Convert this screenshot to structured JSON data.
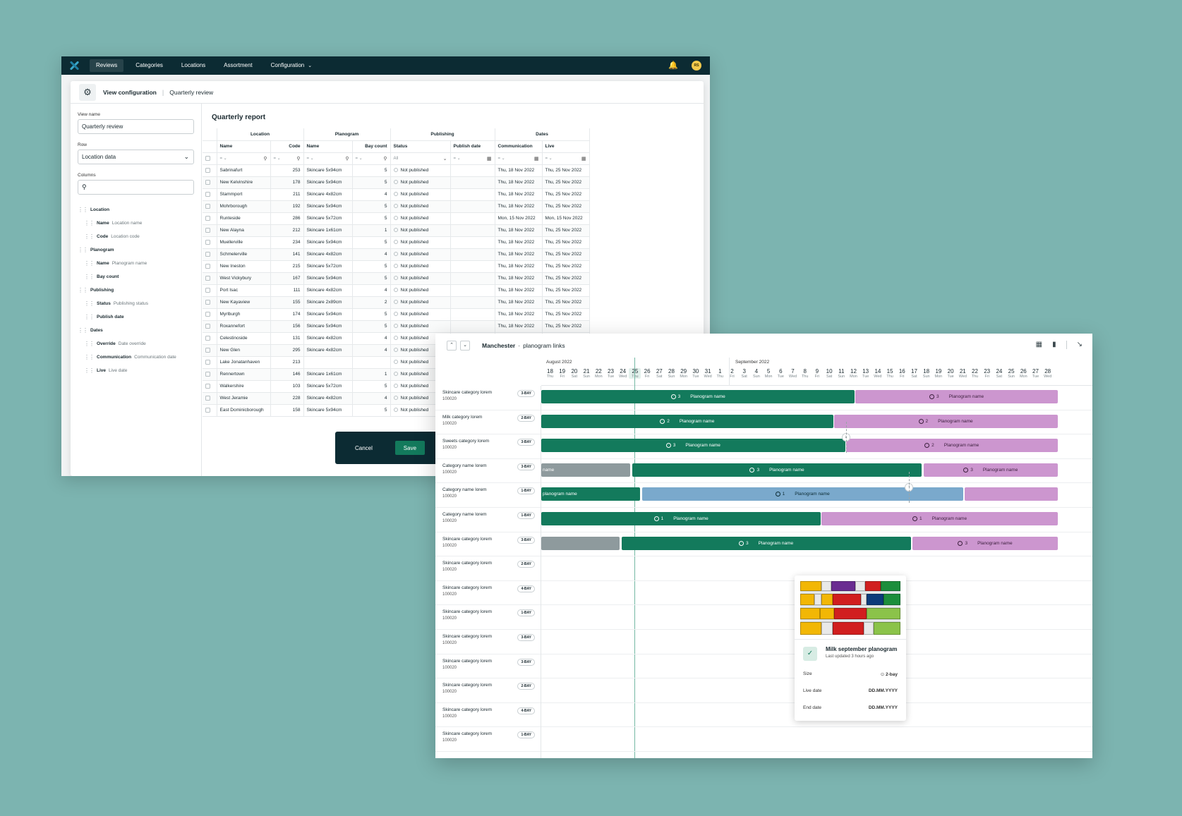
{
  "nav": {
    "items": [
      "Reviews",
      "Categories",
      "Locations",
      "Assortment",
      "Configuration"
    ],
    "avatar": "RS"
  },
  "modal": {
    "title": "View configuration",
    "breadcrumb": "Quarterly review",
    "view_name_label": "View name",
    "view_name_value": "Quarterly review",
    "row_label": "Row",
    "row_value": "Location data",
    "columns_label": "Columns",
    "tree": [
      {
        "name": "Location",
        "level": 0,
        "sub": ""
      },
      {
        "name": "Name",
        "level": 1,
        "sub": "Location name"
      },
      {
        "name": "Code",
        "level": 1,
        "sub": "Location code"
      },
      {
        "name": "Planogram",
        "level": 0,
        "sub": ""
      },
      {
        "name": "Name",
        "level": 1,
        "sub": "Planogram name"
      },
      {
        "name": "Bay count",
        "level": 1,
        "sub": ""
      },
      {
        "name": "Publishing",
        "level": 0,
        "sub": ""
      },
      {
        "name": "Status",
        "level": 1,
        "sub": "Publishing status"
      },
      {
        "name": "Publish date",
        "level": 1,
        "sub": ""
      },
      {
        "name": "Dates",
        "level": 0,
        "sub": ""
      },
      {
        "name": "Override",
        "level": 1,
        "sub": "Date override"
      },
      {
        "name": "Communication",
        "level": 1,
        "sub": "Communication date"
      },
      {
        "name": "Live",
        "level": 1,
        "sub": "Live date"
      }
    ],
    "report_title": "Quarterly report",
    "groups": [
      "Location",
      "Planogram",
      "Publishing",
      "Dates"
    ],
    "columns": [
      "Name",
      "Code",
      "Name",
      "Bay count",
      "Status",
      "Publish date",
      "Communication",
      "Live"
    ],
    "status_filter": "All",
    "rows": [
      [
        "Sabrinafurt",
        "253",
        "Skincare 5x94cm",
        "5",
        "Not published",
        "",
        "Thu, 18 Nov 2022",
        "Thu, 25 Nov 2022"
      ],
      [
        "New Kelvinshire",
        "178",
        "Skincare 5x94cm",
        "5",
        "Not published",
        "",
        "Thu, 18 Nov 2022",
        "Thu, 25 Nov 2022"
      ],
      [
        "Stammport",
        "211",
        "Skincare 4x82cm",
        "4",
        "Not published",
        "",
        "Thu, 18 Nov 2022",
        "Thu, 25 Nov 2022"
      ],
      [
        "Mohrborough",
        "192",
        "Skincare 5x94cm",
        "5",
        "Not published",
        "",
        "Thu, 18 Nov 2022",
        "Thu, 25 Nov 2022"
      ],
      [
        "Runteside",
        "286",
        "Skincare 5x72cm",
        "5",
        "Not published",
        "",
        "Mon, 15 Nov 2022",
        "Mon, 15 Nov 2022"
      ],
      [
        "New Alayna",
        "212",
        "Skincare 1x61cm",
        "1",
        "Not published",
        "",
        "Thu, 18 Nov 2022",
        "Thu, 25 Nov 2022"
      ],
      [
        "Muellerville",
        "234",
        "Skincare 5x94cm",
        "5",
        "Not published",
        "",
        "Thu, 18 Nov 2022",
        "Thu, 25 Nov 2022"
      ],
      [
        "Schmelerville",
        "141",
        "Skincare 4x82cm",
        "4",
        "Not published",
        "",
        "Thu, 18 Nov 2022",
        "Thu, 25 Nov 2022"
      ],
      [
        "New Ineston",
        "215",
        "Skincare 5x72cm",
        "5",
        "Not published",
        "",
        "Thu, 18 Nov 2022",
        "Thu, 25 Nov 2022"
      ],
      [
        "West Vickybury",
        "167",
        "Skincare 5x94cm",
        "5",
        "Not published",
        "",
        "Thu, 18 Nov 2022",
        "Thu, 25 Nov 2022"
      ],
      [
        "Port Isac",
        "111",
        "Skincare 4x82cm",
        "4",
        "Not published",
        "",
        "Thu, 18 Nov 2022",
        "Thu, 25 Nov 2022"
      ],
      [
        "New Kayaview",
        "155",
        "Skincare 2x89cm",
        "2",
        "Not published",
        "",
        "Thu, 18 Nov 2022",
        "Thu, 25 Nov 2022"
      ],
      [
        "Myrlburgh",
        "174",
        "Skincare 5x94cm",
        "5",
        "Not published",
        "",
        "Thu, 18 Nov 2022",
        "Thu, 25 Nov 2022"
      ],
      [
        "Roxannefort",
        "156",
        "Skincare 5x94cm",
        "5",
        "Not published",
        "",
        "Thu, 18 Nov 2022",
        "Thu, 25 Nov 2022"
      ],
      [
        "Celestinoside",
        "131",
        "Skincare 4x82cm",
        "4",
        "Not published",
        "",
        "",
        ""
      ],
      [
        "New Glen",
        "295",
        "Skincare 4x82cm",
        "4",
        "Not published",
        "",
        "",
        ""
      ],
      [
        "Lake Jonatanhaven",
        "213",
        "",
        "",
        "Not published",
        "",
        "",
        ""
      ],
      [
        "Rennertown",
        "146",
        "Skincare 1x61cm",
        "1",
        "Not published",
        "",
        "",
        ""
      ],
      [
        "Walkershire",
        "103",
        "Skincare 5x72cm",
        "5",
        "Not published",
        "",
        "",
        ""
      ],
      [
        "West Jeramie",
        "228",
        "Skincare 4x82cm",
        "4",
        "Not published",
        "",
        "",
        ""
      ],
      [
        "East Dominicborough",
        "158",
        "Skincare 5x94cm",
        "5",
        "Not published",
        "",
        "",
        ""
      ]
    ],
    "cancel_label": "Cancel",
    "save_label": "Save"
  },
  "timeline": {
    "title": "Manchester",
    "subtitle": "planogram links",
    "months": [
      "August 2022",
      "September 2022"
    ],
    "days": [
      [
        "18",
        "Thu"
      ],
      [
        "19",
        "Fri"
      ],
      [
        "20",
        "Sat"
      ],
      [
        "21",
        "Sun"
      ],
      [
        "22",
        "Mon"
      ],
      [
        "23",
        "Tue"
      ],
      [
        "24",
        "Wed"
      ],
      [
        "25",
        "Thu"
      ],
      [
        "26",
        "Fri"
      ],
      [
        "27",
        "Sat"
      ],
      [
        "28",
        "Sun"
      ],
      [
        "29",
        "Mon"
      ],
      [
        "30",
        "Tue"
      ],
      [
        "31",
        "Wed"
      ],
      [
        "1",
        "Thu"
      ],
      [
        "2",
        "Fri"
      ],
      [
        "3",
        "Sat"
      ],
      [
        "4",
        "Sun"
      ],
      [
        "5",
        "Mon"
      ],
      [
        "6",
        "Tue"
      ],
      [
        "7",
        "Wed"
      ],
      [
        "8",
        "Thu"
      ],
      [
        "9",
        "Fri"
      ],
      [
        "10",
        "Sat"
      ],
      [
        "11",
        "Sun"
      ],
      [
        "12",
        "Mon"
      ],
      [
        "13",
        "Tue"
      ],
      [
        "14",
        "Wed"
      ],
      [
        "15",
        "Thu"
      ],
      [
        "16",
        "Fri"
      ],
      [
        "17",
        "Sat"
      ],
      [
        "18",
        "Sun"
      ],
      [
        "19",
        "Mon"
      ],
      [
        "20",
        "Tue"
      ],
      [
        "21",
        "Wed"
      ],
      [
        "22",
        "Thu"
      ],
      [
        "23",
        "Fri"
      ],
      [
        "24",
        "Sat"
      ],
      [
        "25",
        "Sun"
      ],
      [
        "26",
        "Mon"
      ],
      [
        "27",
        "Tue"
      ],
      [
        "28",
        "Wed"
      ]
    ],
    "today_index": 7,
    "rows": [
      {
        "name": "Skincare category lorem",
        "code": "100020",
        "bay": "3-BAY"
      },
      {
        "name": "Milk category lorem",
        "code": "100020",
        "bay": "2-BAY"
      },
      {
        "name": "Sweets category lorem",
        "code": "100020",
        "bay": "3-BAY"
      },
      {
        "name": "Category name lorem",
        "code": "100020",
        "bay": "3-BAY"
      },
      {
        "name": "Category name lorem",
        "code": "100020",
        "bay": "1-BAY"
      },
      {
        "name": "Category name lorem",
        "code": "100020",
        "bay": "1-BAY"
      },
      {
        "name": "Skincare category lorem",
        "code": "100020",
        "bay": "3-BAY"
      },
      {
        "name": "Skincare category lorem",
        "code": "100020",
        "bay": "2-BAY"
      },
      {
        "name": "Skincare category lorem",
        "code": "100020",
        "bay": "4-BAY"
      },
      {
        "name": "Skincare category lorem",
        "code": "100020",
        "bay": "1-BAY"
      },
      {
        "name": "Skincare category lorem",
        "code": "100020",
        "bay": "3-BAY"
      },
      {
        "name": "Skincare category lorem",
        "code": "100020",
        "bay": "3-BAY"
      },
      {
        "name": "Skincare category lorem",
        "code": "100020",
        "bay": "2-BAY"
      },
      {
        "name": "Skincare category lorem",
        "code": "100020",
        "bay": "4-BAY"
      },
      {
        "name": "Skincare category lorem",
        "code": "100020",
        "bay": "1-BAY"
      }
    ],
    "bars": [
      [
        {
          "c": "green",
          "s": 0,
          "e": 25.9,
          "n": "3",
          "t": "Planogram name"
        },
        {
          "c": "pink",
          "s": 25.9,
          "e": 42.6,
          "n": "3",
          "t": "Planogram name"
        }
      ],
      [
        {
          "c": "green",
          "s": 0,
          "e": 24.1,
          "n": "2",
          "t": "Planogram name"
        },
        {
          "c": "pink",
          "s": 24.1,
          "e": 42.6,
          "n": "2",
          "t": "Planogram name"
        }
      ],
      [
        {
          "c": "green",
          "s": 0,
          "e": 25.1,
          "n": "3",
          "t": "Planogram name"
        },
        {
          "c": "pink",
          "s": 25.1,
          "e": 42.6,
          "n": "2",
          "t": "Planogram name"
        }
      ],
      [
        {
          "c": "grey",
          "s": 0,
          "e": 7.4,
          "n": "",
          "t": "name"
        },
        {
          "c": "green",
          "s": 7.5,
          "e": 31.4,
          "n": "3",
          "t": "Planogram name"
        },
        {
          "c": "pink",
          "s": 31.5,
          "e": 42.6,
          "n": "3",
          "t": "Planogram name"
        }
      ],
      [
        {
          "c": "green",
          "s": 0,
          "e": 8.2,
          "n": "",
          "t": "planogram name"
        },
        {
          "c": "blue",
          "s": 8.3,
          "e": 34.8,
          "n": "1",
          "t": "Planogram name"
        },
        {
          "c": "pink",
          "s": 34.9,
          "e": 42.6,
          "n": "",
          "t": ""
        }
      ],
      [
        {
          "c": "green",
          "s": 0,
          "e": 23.1,
          "n": "1",
          "t": "Planogram name"
        },
        {
          "c": "pink",
          "s": 23.1,
          "e": 42.6,
          "n": "1",
          "t": "Planogram name"
        }
      ],
      [
        {
          "c": "grey",
          "s": 0,
          "e": 6.5,
          "n": "",
          "t": ""
        },
        {
          "c": "green",
          "s": 6.6,
          "e": 30.5,
          "n": "3",
          "t": "Planogram name"
        },
        {
          "c": "pink",
          "s": 30.6,
          "e": 42.6,
          "n": "3",
          "t": "Planogram name"
        }
      ]
    ],
    "card": {
      "title": "Milk september planogram",
      "updated": "Last updated 3 hours ago",
      "size_label": "Size",
      "size_value": "2-bay",
      "live_label": "Live date",
      "live_value": "DD.MM.YYYY",
      "end_label": "End date",
      "end_value": "DD.MM.YYYY"
    }
  },
  "colors": {
    "accent": "#137a5c",
    "planned": "#cc96cf",
    "archived": "#8e9a9d",
    "draft": "#7aa9cc",
    "nav": "#0c2b33",
    "background": "#7cb4b0"
  }
}
